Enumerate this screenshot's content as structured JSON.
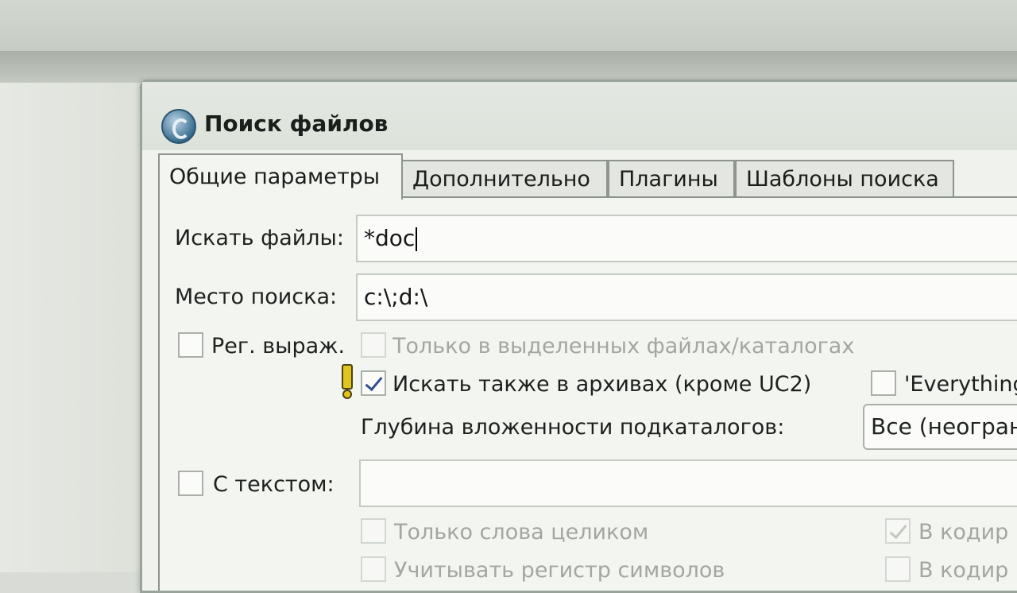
{
  "window": {
    "title": "Поиск файлов",
    "icon": "total-commander-icon"
  },
  "tabs": [
    {
      "label": "Общие параметры",
      "active": true
    },
    {
      "label": "Дополнительно",
      "active": false
    },
    {
      "label": "Плагины",
      "active": false
    },
    {
      "label": "Шаблоны поиска",
      "active": false
    }
  ],
  "form": {
    "search_files": {
      "label": "Искать файлы:",
      "value": "*doc"
    },
    "search_location": {
      "label": "Место поиска:",
      "value": "c:\\;d:\\"
    },
    "regex": {
      "label": "Рег. выраж.",
      "checked": false
    },
    "selected_only": {
      "label": "Только в выделенных файлах/каталогах",
      "checked": false,
      "disabled": true
    },
    "archives": {
      "label": "Искать также в архивах (кроме UC2)",
      "checked": true,
      "warning_icon": "exclamation-icon"
    },
    "everything": {
      "label": "'Everything",
      "checked": false
    },
    "depth": {
      "label": "Глубина вложенности подкаталогов:",
      "value": "Все (неогран"
    },
    "with_text": {
      "label": "С текстом:",
      "value": "",
      "checked": false
    },
    "whole_words": {
      "label": "Только слова целиком",
      "checked": false,
      "disabled": true
    },
    "encoding1": {
      "label": "В кодир",
      "checked": true,
      "disabled": true
    },
    "case_sensitive": {
      "label": "Учитывать регистр символов",
      "checked": false,
      "disabled": true
    },
    "encoding2": {
      "label": "В кодир",
      "checked": false,
      "disabled": true
    }
  }
}
